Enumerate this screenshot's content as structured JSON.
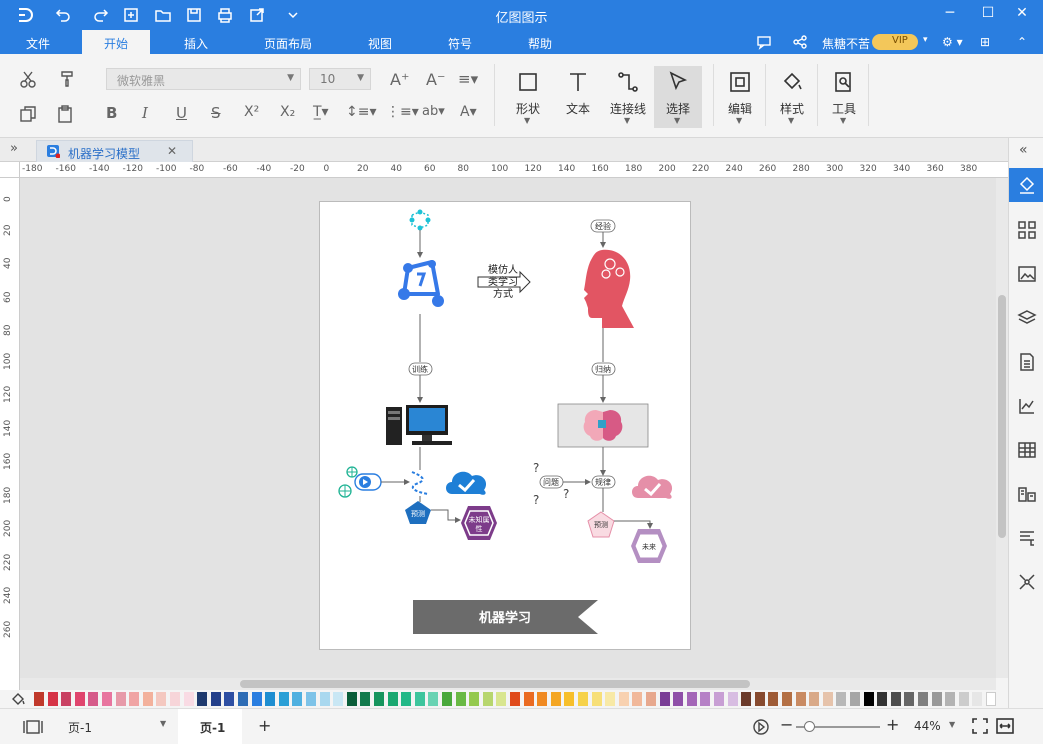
{
  "app": {
    "title": "亿图图示",
    "user": "焦糖不苦",
    "vip_badge": "VIP"
  },
  "menus": [
    "文件",
    "开始",
    "插入",
    "页面布局",
    "视图",
    "符号",
    "帮助"
  ],
  "active_menu": "开始",
  "ribbon": {
    "font_family": "微软雅黑",
    "font_size": "10",
    "shape_label": "形状",
    "text_label": "文本",
    "connector_label": "连接线",
    "select_label": "选择",
    "edit_label": "编辑",
    "style_label": "样式",
    "tools_label": "工具"
  },
  "document_tab": {
    "name": "机器学习模型",
    "close": "✕"
  },
  "ruler": {
    "horizontal": [
      "-180",
      "-160",
      "-140",
      "-120",
      "-100",
      "-80",
      "-60",
      "-40",
      "-20",
      "0",
      "20",
      "40",
      "60",
      "80",
      "100",
      "120",
      "140",
      "160",
      "180",
      "200",
      "220",
      "240",
      "260",
      "280",
      "300",
      "320",
      "340",
      "360",
      "380"
    ],
    "vertical": [
      "0",
      "20",
      "40",
      "60",
      "80",
      "100",
      "120",
      "140",
      "160",
      "180",
      "200",
      "220",
      "240",
      "260"
    ]
  },
  "diagram": {
    "mimic_label_l1": "模仿人",
    "mimic_label_l2": "类学习",
    "mimic_label_l3": "方式",
    "experience": "经验",
    "train": "训练",
    "induce": "归纳",
    "predict_left": "预测",
    "unknown_attr_l1": "未知属",
    "unknown_attr_l2": "性",
    "problem": "问题",
    "rule": "规律",
    "predict_right": "预测",
    "future": "未来",
    "question_mark": "?",
    "banner": "机器学习"
  },
  "palette_colors": [
    "#c0392b",
    "#d63447",
    "#c94163",
    "#e0456e",
    "#d65b8a",
    "#e8759f",
    "#e79aa9",
    "#f0a4a4",
    "#f3b19c",
    "#f4c8c0",
    "#f7d5d9",
    "#f9dbe4",
    "#1f3a6e",
    "#233f8a",
    "#2e4fa3",
    "#2f6db5",
    "#2a7ee0",
    "#1e8ed1",
    "#2a9fd6",
    "#4fb0e0",
    "#7ec3e8",
    "#a9d8ef",
    "#c9e7f4",
    "#0b5e3a",
    "#127a4c",
    "#17955e",
    "#1ba871",
    "#22b887",
    "#3ec59d",
    "#69d3b3",
    "#49a83b",
    "#69b944",
    "#94c94e",
    "#b7d66e",
    "#d9e68f",
    "#e04b1c",
    "#ea6b22",
    "#f08a22",
    "#f4a623",
    "#f7bf2b",
    "#f6d24a",
    "#f7df78",
    "#f8e9a6",
    "#f8d1b0",
    "#f1b89a",
    "#e7a88e",
    "#7a3e96",
    "#8f4fa8",
    "#a466b7",
    "#b681c6",
    "#c89fd4",
    "#d8bde2",
    "#6b3a2a",
    "#874a2f",
    "#9e5b36",
    "#b47045",
    "#c98b63",
    "#d9a988",
    "#e6c3ab",
    "#b8b8b8",
    "#a6a6a6",
    "#000000",
    "#333333",
    "#4d4d4d",
    "#666666",
    "#808080",
    "#999999",
    "#b3b3b3",
    "#cccccc",
    "#e6e6e6",
    "#ffffff"
  ],
  "status": {
    "page_select": "页-1",
    "page_tab": "页-1",
    "add_page": "+",
    "zoom": "44%",
    "zoom_minus": "−",
    "zoom_plus": "+"
  }
}
